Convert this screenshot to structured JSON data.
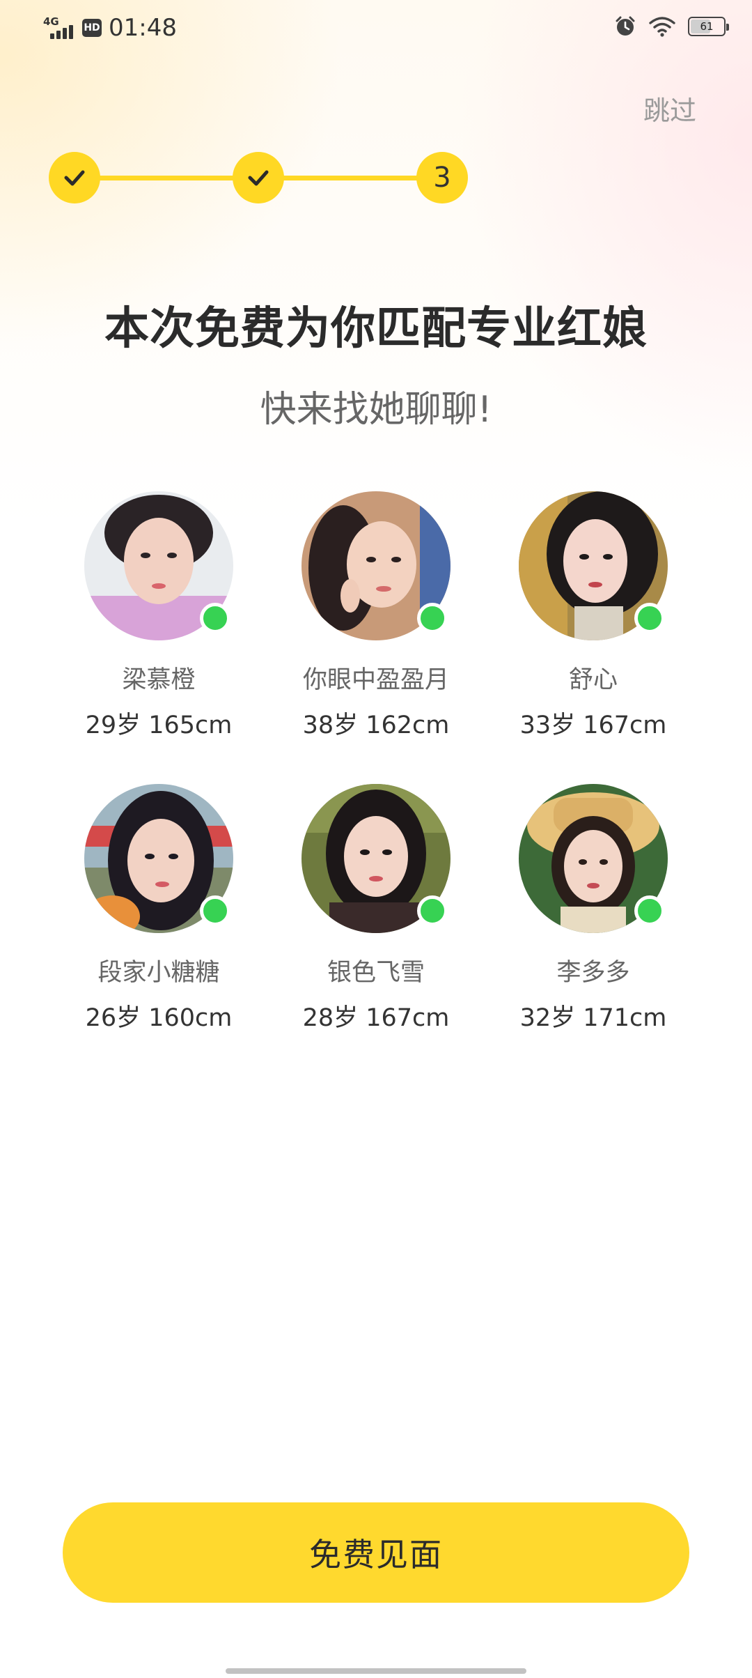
{
  "status_bar": {
    "network": "4G",
    "hd": "HD",
    "time": "01:48",
    "battery": "61",
    "battery_level": 0.61,
    "icons": [
      "signal-icon",
      "alarm-icon",
      "wifi-icon",
      "battery-icon"
    ]
  },
  "header": {
    "skip_label": "跳过"
  },
  "stepper": {
    "steps": [
      {
        "state": "done",
        "icon": "check-icon"
      },
      {
        "state": "done",
        "icon": "check-icon"
      },
      {
        "state": "current",
        "label": "3"
      }
    ],
    "color": "#ffd824"
  },
  "main": {
    "title": "本次免费为你匹配专业红娘",
    "subtitle": "快来找她聊聊!"
  },
  "profiles": [
    {
      "name": "梁慕橙",
      "info": "29岁 165cm",
      "online": true
    },
    {
      "name": "你眼中盈盈月",
      "info": "38岁 162cm",
      "online": true
    },
    {
      "name": "舒心",
      "info": "33岁 167cm",
      "online": true
    },
    {
      "name": "段家小糖糖",
      "info": "26岁 160cm",
      "online": true
    },
    {
      "name": "银色飞雪",
      "info": "28岁 167cm",
      "online": true
    },
    {
      "name": "李多多",
      "info": "32岁 171cm",
      "online": true
    }
  ],
  "cta": {
    "label": "免费见面",
    "color": "#ffd92e"
  },
  "colors": {
    "accent": "#ffd824",
    "online": "#37d253",
    "title_text": "#2b2b2b",
    "secondary_text": "#666666"
  }
}
